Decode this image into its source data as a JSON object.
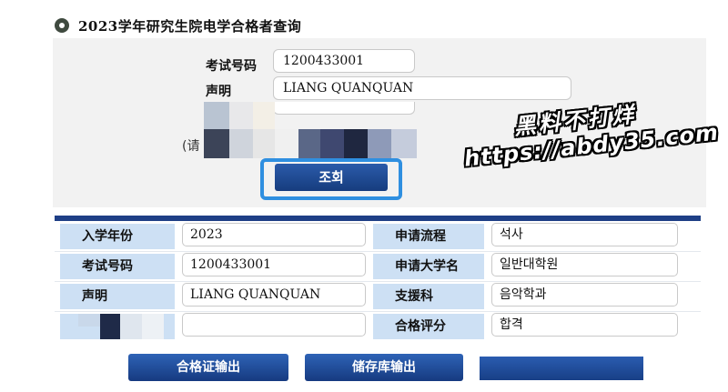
{
  "header": {
    "title": "2023学年研究生院电学合格者查询",
    "icon": "circle-bullet-icon"
  },
  "search": {
    "exam_no_label": "考试号码",
    "exam_no_value": "1200433001",
    "name_label": "声明",
    "name_value": "LIANG QUANQUAN",
    "hint_fragment": "(请",
    "query_button": "조회"
  },
  "result": {
    "rows": [
      {
        "label": "入学年份",
        "value": "2023",
        "label2": "申请流程",
        "value2": "석사"
      },
      {
        "label": "考试号码",
        "value": "1200433001",
        "label2": "申请大学名",
        "value2": "일반대학원"
      },
      {
        "label": "声明",
        "value": "LIANG QUANQUAN",
        "label2": "支援科",
        "value2": "음악학과"
      },
      {
        "label": "",
        "value": "",
        "label2": "合格评分",
        "value2": "합격"
      }
    ]
  },
  "actions": {
    "certificate_button": "合格证输出",
    "archive_button": "储存库输出"
  },
  "watermark": {
    "line1": "黑料不打烊",
    "line2": "https://abdy35.com"
  },
  "colors": {
    "primary_button": "#1e3f86",
    "label_cell": "#cde0f4",
    "query_frame": "#2f8fe0",
    "panel_bg": "#f2f2f2"
  }
}
